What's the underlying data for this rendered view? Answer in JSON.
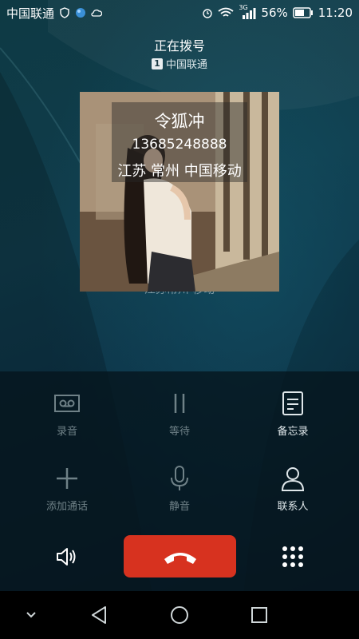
{
  "status_bar": {
    "carrier": "中国联通",
    "network": "3G",
    "battery_percent": "56%",
    "time": "11:20"
  },
  "call": {
    "status": "正在拨号",
    "sim_slot": "1",
    "sim_carrier": "中国联通",
    "contact_name": "令狐冲",
    "contact_number": "13685248888",
    "contact_location": "江苏 常州 中国移动",
    "ghost_location": "江苏常州 移动"
  },
  "controls": {
    "record_label": "录音",
    "hold_label": "等待",
    "memo_label": "备忘录",
    "add_call_label": "添加通话",
    "mute_label": "静音",
    "contacts_label": "联系人"
  },
  "colors": {
    "end_call": "#d7321f",
    "disabled_text": "#6f8187",
    "enabled_text": "#dfe7ea"
  }
}
